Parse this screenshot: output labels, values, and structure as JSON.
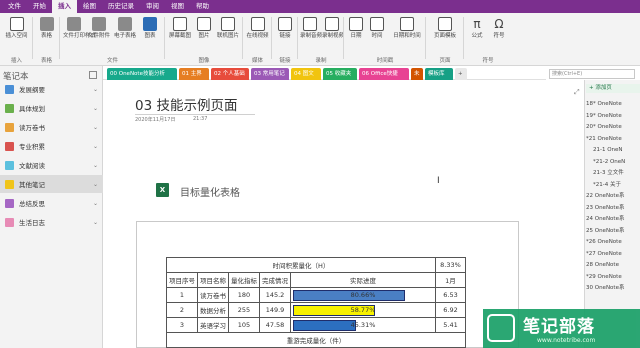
{
  "menu_tabs": [
    "文件",
    "开始",
    "插入",
    "绘图",
    "历史记录",
    "审阅",
    "视图",
    "帮助"
  ],
  "ribbon": {
    "groups": [
      {
        "label": "插入",
        "buttons": [
          "插入空间"
        ]
      },
      {
        "label": "表格",
        "buttons": [
          "表格"
        ]
      },
      {
        "label": "文件",
        "buttons": [
          "文件打印样式",
          "文件附件",
          "电子表格",
          "图表"
        ]
      },
      {
        "label": "图像",
        "buttons": [
          "屏幕截图",
          "图片",
          "联机图片"
        ]
      },
      {
        "label": "媒体",
        "buttons": [
          "在线视频"
        ]
      },
      {
        "label": "链接",
        "buttons": [
          "链接"
        ]
      },
      {
        "label": "录制",
        "buttons": [
          "录制音频",
          "录制视频"
        ]
      },
      {
        "label": "时间戳",
        "buttons": [
          "日期",
          "时间",
          "日期和时间"
        ]
      },
      {
        "label": "页面",
        "buttons": [
          "页面模板"
        ]
      },
      {
        "label": "符号",
        "buttons": [
          "公式",
          "符号"
        ]
      }
    ]
  },
  "notebook": {
    "title": "笔记本",
    "sections": [
      {
        "label": "发展纲要",
        "color": "#4a8fd6"
      },
      {
        "label": "具体规划",
        "color": "#6ab04c"
      },
      {
        "label": "读万卷书",
        "color": "#e8a33c"
      },
      {
        "label": "专业积累",
        "color": "#d9534f"
      },
      {
        "label": "文献阅读",
        "color": "#5bc0de"
      },
      {
        "label": "其他笔记",
        "color": "#f0c419"
      },
      {
        "label": "总结反思",
        "color": "#a567c4"
      },
      {
        "label": "生活日志",
        "color": "#e78bb5"
      }
    ]
  },
  "section_tabs": [
    {
      "label": "00 OneNote技能分析",
      "color": "#17a98c"
    },
    {
      "label": "01 主界",
      "color": "#e67e22"
    },
    {
      "label": "02 个人基础",
      "color": "#e74c3c"
    },
    {
      "label": "03 常用笔记",
      "color": "#9b59b6"
    },
    {
      "label": "04 图文",
      "color": "#f1c40f"
    },
    {
      "label": "05 收藏夹",
      "color": "#27ae60"
    },
    {
      "label": "06 Office快捷",
      "color": "#e84393"
    },
    {
      "label": "未",
      "color": "#d35400"
    },
    {
      "label": "模板库",
      "color": "#16a085"
    },
    {
      "label": "+",
      "color": "#bbbbbb"
    }
  ],
  "search": {
    "placeholder": "搜索(Ctrl+E)"
  },
  "page": {
    "title": "03 技能示例页面",
    "date": "2020年11月17日",
    "time": "21:37",
    "embed_title": "目标量化表格"
  },
  "table": {
    "header_title": "时间积累量化（H）",
    "header_pct": "8.33%",
    "columns": [
      "项目序号",
      "项目名称",
      "量化指标",
      "完成情况",
      "实际进度",
      "1月"
    ],
    "rows": [
      {
        "no": "1",
        "name": "读万卷书",
        "target": "180",
        "done": "145.2",
        "progress": 80.66,
        "progress_label": "80.66%",
        "bar_color": "#4a7fc4",
        "month": "6.53"
      },
      {
        "no": "2",
        "name": "数据分析",
        "target": "255",
        "done": "149.9",
        "progress": 58.77,
        "progress_label": "58.77%",
        "bar_color": "#f7f100",
        "month": "6.92"
      },
      {
        "no": "3",
        "name": "英语学习",
        "target": "105",
        "done": "47.58",
        "progress": 45.31,
        "progress_label": "45.31%",
        "bar_color": "#2c6fc0",
        "month": "5.41"
      }
    ],
    "footer": "重游完成量化（件）"
  },
  "page_list": {
    "add_label": "+ 添加页",
    "items": [
      {
        "label": "18* OneNote",
        "level": 0
      },
      {
        "label": "19* OneNote",
        "level": 0
      },
      {
        "label": "20* OneNote",
        "level": 0
      },
      {
        "label": "*21 OneNote",
        "level": 0
      },
      {
        "label": "21-1 OneN",
        "level": 1
      },
      {
        "label": "*21-2 OneN",
        "level": 1
      },
      {
        "label": "21-3 立文件",
        "level": 1
      },
      {
        "label": "*21-4 关于",
        "level": 1
      },
      {
        "label": "22 OneNote系",
        "level": 0
      },
      {
        "label": "23 OneNote系",
        "level": 0
      },
      {
        "label": "24 OneNote系",
        "level": 0
      },
      {
        "label": "25 OneNote系",
        "level": 0
      },
      {
        "label": "*26 OneNote",
        "level": 0
      },
      {
        "label": "*27 OneNote",
        "level": 0
      },
      {
        "label": "28 OneNote",
        "level": 0
      },
      {
        "label": "*29 OneNote",
        "level": 0
      },
      {
        "label": "30 OneNote系",
        "level": 0
      }
    ]
  },
  "watermark": {
    "title": "笔记部落",
    "subtitle": "www.notetribe.com"
  }
}
